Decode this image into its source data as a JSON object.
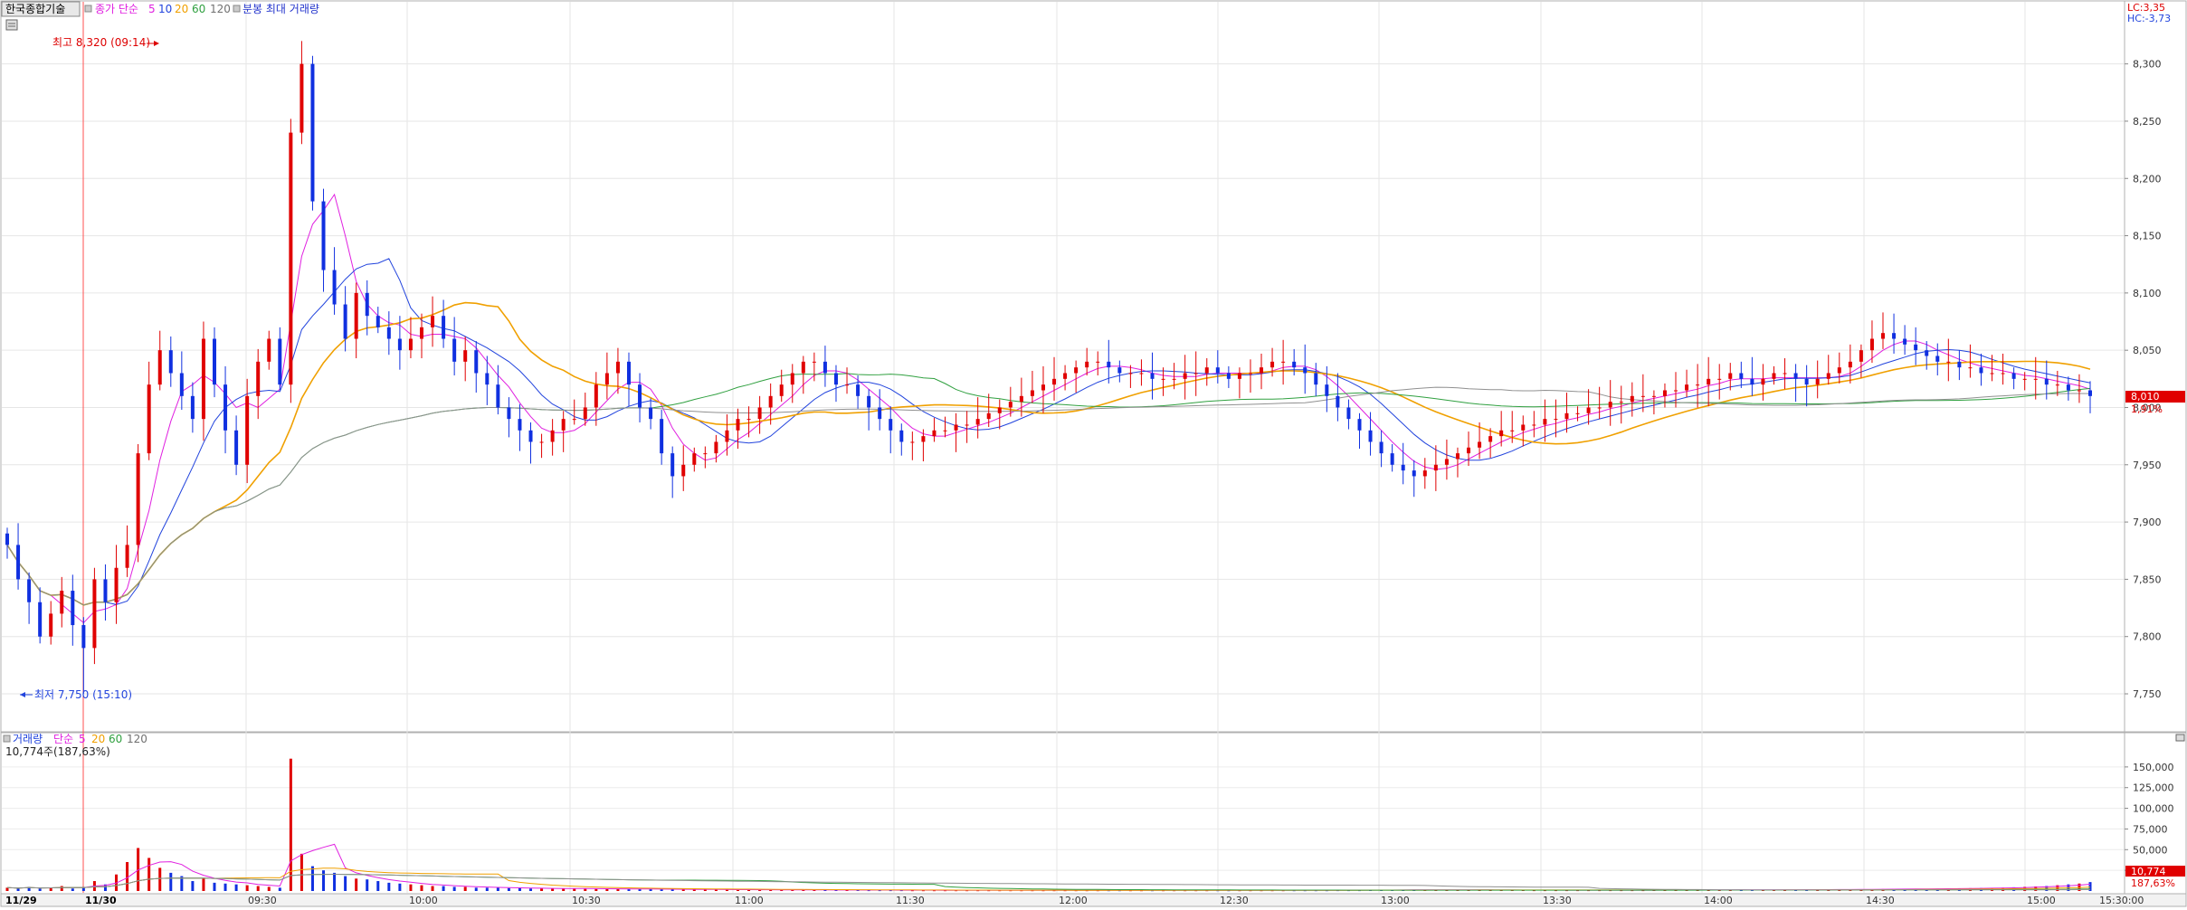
{
  "header": {
    "stock_name": "한국종합기술",
    "ma_label": "종가 단순",
    "ma_periods": [
      "5",
      "10",
      "20",
      "60",
      "120"
    ],
    "ma_colors": [
      "#e020e0",
      "#2244dd",
      "#f0a000",
      "#30a040",
      "#909090"
    ],
    "mode_label": "분봉 최대 거래량"
  },
  "price_panel": {
    "lc_label": "LC:3,35",
    "hc_label": "HC:-3,73",
    "high_marker": "최고 8,320 (09:14)",
    "low_marker": "최저 7,750 (15:10)",
    "current_price_tag": "8,010",
    "current_change_tag": "1,91%"
  },
  "volume_panel": {
    "label": "거래량",
    "ma_label": "단순",
    "ma_periods": [
      "5",
      "20",
      "60",
      "120"
    ],
    "current_volume_text": "10,774주(187,63%)",
    "current_volume_tag": "10,774",
    "current_ratio_tag": "187,63%"
  },
  "chart_data": [
    {
      "type": "candlestick",
      "title": "한국종합기술",
      "y_tick_labels": [
        "8,300",
        "8,250",
        "8,200",
        "8,150",
        "8,100",
        "8,050",
        "8,000",
        "7,950",
        "7,900",
        "7,850",
        "7,800",
        "7,750"
      ],
      "ylim": [
        7720,
        8340
      ],
      "x_tick_labels": [
        "11/29",
        "11/30",
        "09:30",
        "10:00",
        "10:30",
        "11:00",
        "11:30",
        "12:00",
        "12:30",
        "13:00",
        "13:30",
        "14:00",
        "14:30",
        "15:00",
        "15:30:00"
      ],
      "high": 8320,
      "high_time": "09:14",
      "low": 7750,
      "low_time": "15:10",
      "last_close": 8010,
      "closes": [
        7880,
        7850,
        7830,
        7800,
        7820,
        7840,
        7810,
        7790,
        7850,
        7830,
        7860,
        7880,
        7960,
        8020,
        8050,
        8030,
        8010,
        7990,
        8060,
        8020,
        7980,
        7950,
        8010,
        8040,
        8060,
        8020,
        8240,
        8300,
        8180,
        8120,
        8090,
        8060,
        8100,
        8080,
        8070,
        8060,
        8050,
        8060,
        8070,
        8080,
        8060,
        8040,
        8050,
        8030,
        8020,
        8000,
        7990,
        7980,
        7970,
        7970,
        7980,
        7990,
        7990,
        8000,
        8020,
        8030,
        8040,
        8020,
        8000,
        7990,
        7960,
        7940,
        7950,
        7960,
        7960,
        7970,
        7980,
        7990,
        7990,
        8000,
        8010,
        8020,
        8030,
        8040,
        8040,
        8030,
        8020,
        8020,
        8010,
        8000,
        7990,
        7980,
        7970,
        7970,
        7975,
        7980,
        7980,
        7985,
        7985,
        7990,
        7995,
        8000,
        8005,
        8010,
        8015,
        8020,
        8025,
        8030,
        8035,
        8040,
        8040,
        8035,
        8030,
        8030,
        8030,
        8025,
        8025,
        8025,
        8030,
        8030,
        8035,
        8030,
        8025,
        8030,
        8030,
        8035,
        8040,
        8040,
        8035,
        8030,
        8020,
        8010,
        8000,
        7990,
        7980,
        7970,
        7960,
        7950,
        7945,
        7940,
        7945,
        7950,
        7955,
        7960,
        7965,
        7970,
        7975,
        7980,
        7980,
        7985,
        7985,
        7990,
        7990,
        7995,
        7995,
        8000,
        8000,
        8005,
        8005,
        8010,
        8010,
        8010,
        8015,
        8015,
        8020,
        8020,
        8025,
        8025,
        8030,
        8025,
        8020,
        8025,
        8030,
        8030,
        8025,
        8020,
        8025,
        8030,
        8035,
        8040,
        8050,
        8060,
        8065,
        8060,
        8055,
        8050,
        8045,
        8040,
        8040,
        8035,
        8035,
        8030,
        8030,
        8030,
        8025,
        8025,
        8025,
        8020,
        8020,
        8015,
        8015,
        8010
      ],
      "series": [
        {
          "name": "5",
          "color": "#e020e0"
        },
        {
          "name": "10",
          "color": "#2244dd"
        },
        {
          "name": "20",
          "color": "#f0a000"
        },
        {
          "name": "60",
          "color": "#30a040"
        },
        {
          "name": "120",
          "color": "#909090"
        }
      ]
    },
    {
      "type": "bar",
      "title": "거래량",
      "y_tick_labels": [
        "150,000",
        "125,000",
        "100,000",
        "75,000",
        "50,000",
        "25,000"
      ],
      "ylim": [
        0,
        175000
      ],
      "volumes": [
        4000,
        3000,
        5000,
        3000,
        4000,
        6000,
        3000,
        5000,
        12000,
        8000,
        20000,
        35000,
        52000,
        40000,
        28000,
        22000,
        18000,
        12000,
        15000,
        10000,
        9000,
        8000,
        7000,
        6000,
        5000,
        4000,
        160000,
        45000,
        30000,
        25000,
        22000,
        18000,
        15000,
        14000,
        12000,
        10000,
        9000,
        8000,
        7000,
        6000,
        6000,
        5000,
        5000,
        4000,
        4000,
        4000,
        3500,
        3500,
        3000,
        3000,
        3000,
        3000,
        2800,
        2800,
        2600,
        2500,
        2500,
        2400,
        2300,
        2200,
        2000,
        2000,
        2000,
        1800,
        1800,
        1700,
        1600,
        1500,
        1500,
        1500,
        1400,
        1400,
        1300,
        1300,
        1200,
        1200,
        1200,
        1100,
        1100,
        1000,
        1000,
        1000,
        1000,
        900,
        900,
        900,
        900,
        900,
        900,
        900,
        900,
        900,
        900,
        900,
        900,
        900,
        900,
        900,
        900,
        900,
        900,
        900,
        900,
        900,
        900,
        900,
        900,
        900,
        900,
        900,
        900,
        900,
        900,
        900,
        900,
        900,
        900,
        900,
        900,
        900,
        900,
        900,
        1000,
        1000,
        1000,
        1200,
        1200,
        1200,
        1300,
        1400,
        1500,
        1500,
        1500,
        1400,
        1300,
        1200,
        1200,
        1100,
        1100,
        1100,
        1000,
        1000,
        1000,
        1000,
        1000,
        1000,
        1000,
        1000,
        1000,
        1000,
        1000,
        1100,
        1100,
        1100,
        1200,
        1200,
        1200,
        1300,
        1300,
        1300,
        1300,
        1400,
        1400,
        1500,
        1500,
        1600,
        1700,
        1800,
        1900,
        2000,
        2100,
        2200,
        2300,
        2400,
        2500,
        2600,
        2700,
        2800,
        3000,
        3200,
        3400,
        3600,
        3800,
        4000,
        4500,
        5000,
        5500,
        6000,
        7000,
        8000,
        9000,
        10774
      ]
    }
  ]
}
